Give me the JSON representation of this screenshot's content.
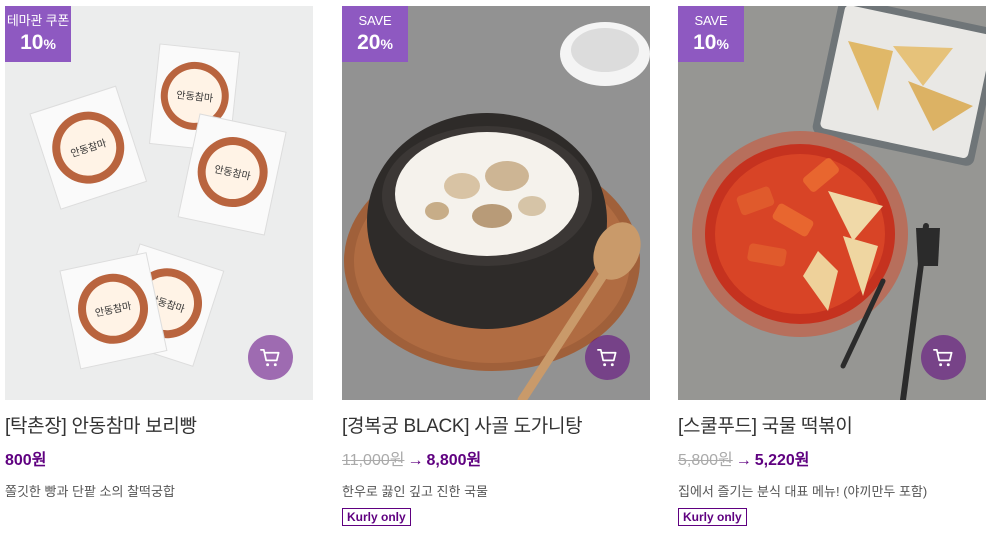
{
  "products": [
    {
      "badge_top": "테마관 쿠폰",
      "badge_pct": "10",
      "badge_unit": "%",
      "name": "[탁촌장] 안동참마 보리빵",
      "price_original": "",
      "price_arrow": "",
      "price_sale": "800원",
      "description": "쫄깃한 빵과 단팥 소의 찰떡궁합",
      "tag": ""
    },
    {
      "badge_top": "SAVE",
      "badge_pct": "20",
      "badge_unit": "%",
      "name": "[경복궁 BLACK] 사골 도가니탕",
      "price_original": "11,000원",
      "price_arrow": "→",
      "price_sale": "8,800원",
      "description": "한우로 끓인 깊고 진한 국물",
      "tag": "Kurly only"
    },
    {
      "badge_top": "SAVE",
      "badge_pct": "10",
      "badge_unit": "%",
      "name": "[스쿨푸드] 국물 떡볶이",
      "price_original": "5,800원",
      "price_arrow": "→",
      "price_sale": "5,220원",
      "description": "집에서 즐기는 분식 대표 메뉴! (야끼만두 포함)",
      "tag": "Kurly only"
    }
  ],
  "colors": {
    "accent": "#5f0080",
    "badge": "#8e59c1",
    "strike": "#aaaaaa"
  },
  "icons": {
    "cart": "cart-icon"
  }
}
